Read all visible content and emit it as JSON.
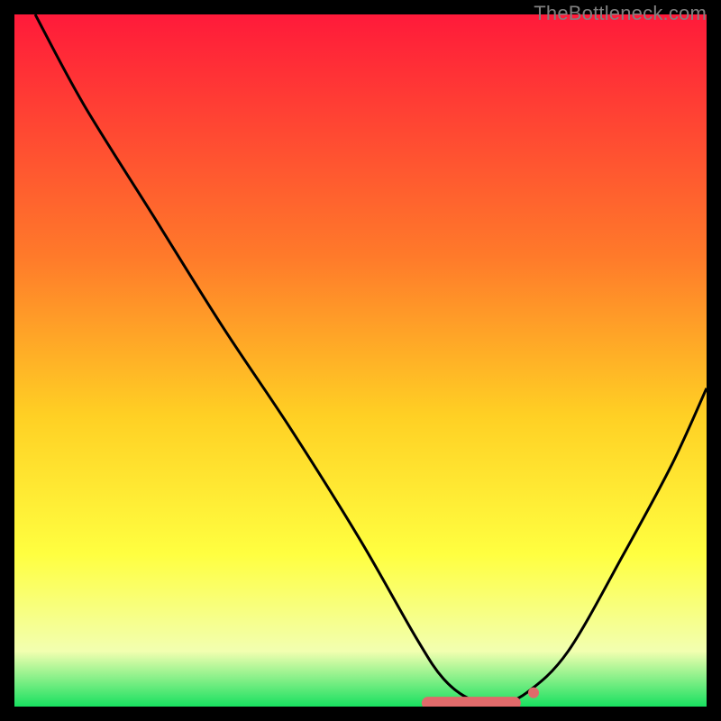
{
  "watermark": "TheBottleneck.com",
  "gradient": {
    "top": "#ff1a3a",
    "mid1": "#ff7a2a",
    "mid2": "#ffd024",
    "mid3": "#ffff40",
    "mid4": "#f2ffb0",
    "bottom": "#18e060"
  },
  "curve_color": "#000000",
  "curve_width": 3,
  "marker_color": "#e06a6a",
  "marker_radius_small": 6,
  "marker_cap_width": 110,
  "marker_cap_height": 14,
  "chart_data": {
    "type": "line",
    "title": "",
    "xlabel": "",
    "ylabel": "",
    "xlim": [
      0,
      100
    ],
    "ylim": [
      0,
      100
    ],
    "series": [
      {
        "name": "curve",
        "x": [
          3,
          10,
          20,
          30,
          40,
          50,
          58,
          62,
          66,
          70,
          74,
          80,
          88,
          95,
          100
        ],
        "values": [
          100,
          87,
          71,
          55,
          40,
          24,
          10,
          4,
          1,
          0.5,
          2,
          8,
          22,
          35,
          46
        ]
      }
    ],
    "markers": {
      "cap_center_x": 66,
      "cap_y": 0.5,
      "dot_x": 75,
      "dot_y": 2
    }
  }
}
